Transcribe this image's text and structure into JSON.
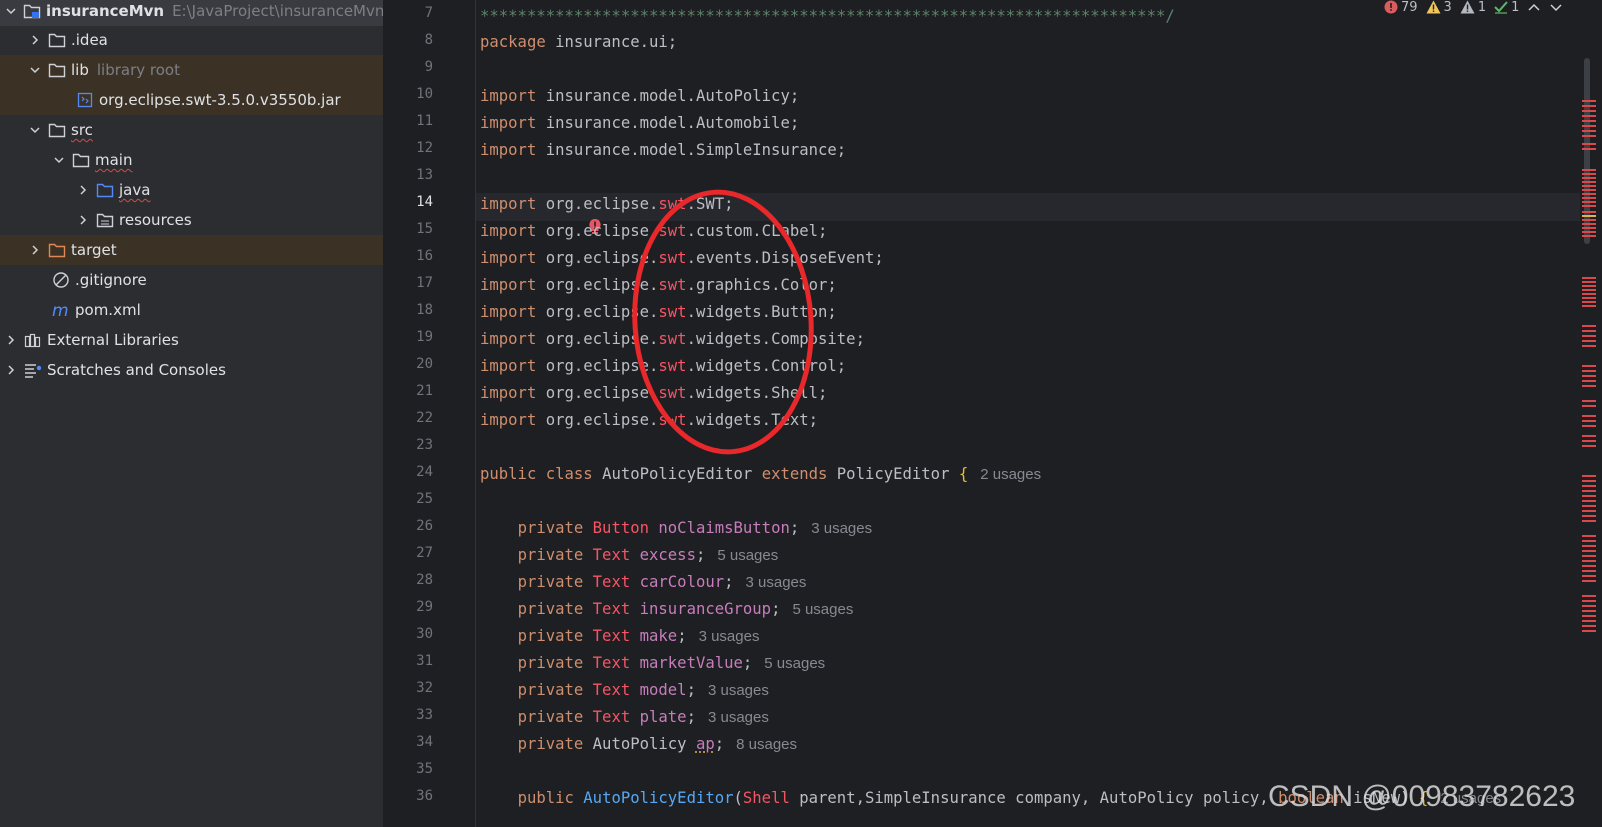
{
  "project_tree": {
    "root": {
      "name": "insuranceMvn",
      "path": "E:\\JavaProject\\insuranceMvn"
    },
    "idea": ".idea",
    "lib": {
      "name": "lib",
      "hint": "library root"
    },
    "jar": "org.eclipse.swt-3.5.0.v3550b.jar",
    "src": "src",
    "main": "main",
    "java": "java",
    "resources": "resources",
    "target": "target",
    "gitignore": ".gitignore",
    "pom": "pom.xml",
    "external_libraries": "External Libraries",
    "scratches": "Scratches and Consoles"
  },
  "status": {
    "errors": "79",
    "warnings": "3",
    "weak_warnings": "1",
    "ok": "1"
  },
  "line_numbers": [
    "7",
    "8",
    "9",
    "10",
    "11",
    "12",
    "13",
    "14",
    "15",
    "16",
    "17",
    "18",
    "19",
    "20",
    "21",
    "22",
    "23",
    "24",
    "25",
    "26",
    "27",
    "28",
    "29",
    "30",
    "31",
    "32",
    "33",
    "34",
    "35",
    "36"
  ],
  "code": {
    "l7": "*************************************************************************/",
    "l8": {
      "kw": "package",
      "rest": " insurance.ui;"
    },
    "import_kw": "import",
    "l10": " insurance.model.AutoPolicy;",
    "l11": " insurance.model.Automobile;",
    "l12": " insurance.model.SimpleInsurance;",
    "eclipse_prefix": " org.eclipse.",
    "swt": "swt",
    "l14": ".SWT;",
    "l15": ".custom.CLabel;",
    "l16": ".events.DisposeEvent;",
    "l17": ".graphics.Color;",
    "l18": ".widgets.Button;",
    "l19": ".widgets.Composite;",
    "l20": ".widgets.Control;",
    "l21": ".widgets.Shell;",
    "l22": ".widgets.Text;",
    "l24": {
      "public": "public",
      "class": "class",
      "name": " AutoPolicyEditor ",
      "extends": "extends",
      "super": " PolicyEditor ",
      "brace": "{",
      "usages": "2 usages"
    },
    "private": "private",
    "fields": [
      {
        "type": "Button",
        "name": "noClaimsButton",
        "usages": "3 usages"
      },
      {
        "type": "Text",
        "name": "excess",
        "usages": "5 usages"
      },
      {
        "type": "Text",
        "name": "carColour",
        "usages": "3 usages"
      },
      {
        "type": "Text",
        "name": "insuranceGroup",
        "usages": "5 usages"
      },
      {
        "type": "Text",
        "name": "make",
        "usages": "3 usages"
      },
      {
        "type": "Text",
        "name": "marketValue",
        "usages": "5 usages"
      },
      {
        "type": "Text",
        "name": "model",
        "usages": "3 usages"
      },
      {
        "type": "Text",
        "name": "plate",
        "usages": "3 usages"
      },
      {
        "type": "AutoPolicy",
        "name": "ap",
        "usages": "8 usages"
      }
    ],
    "l36": {
      "public": "public",
      "ctor": "AutoPolicyEditor",
      "open": "(",
      "shell": "Shell",
      "p1": " parent,SimpleInsurance company, AutoPolicy policy, ",
      "bool": "boolean",
      "p2": " isNew) ",
      "brace": "{",
      "usages": "2 usages"
    }
  },
  "watermark": "CSDN @00983782623",
  "colors": {
    "annotation": "#e8282b",
    "error": "#d9484b",
    "warning": "#e0b14c"
  }
}
